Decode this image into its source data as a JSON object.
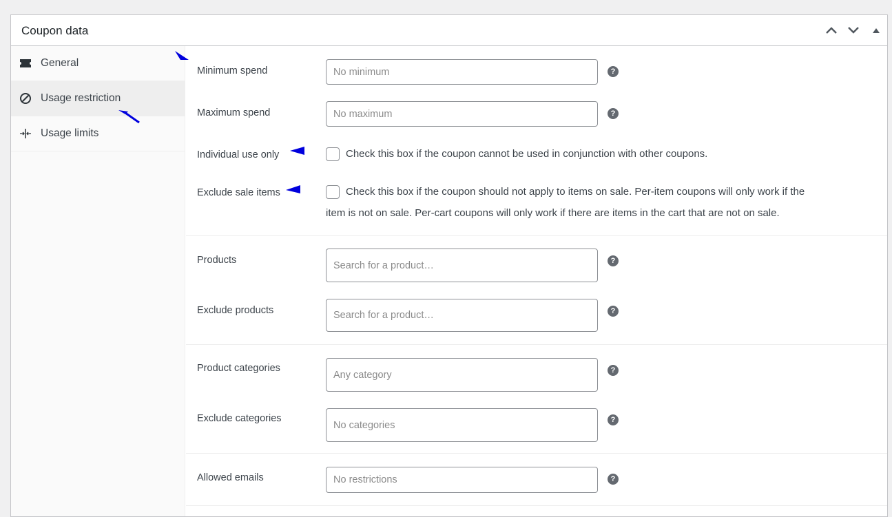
{
  "panel": {
    "title": "Coupon data",
    "controls": [
      "chevron-up-icon",
      "chevron-down-icon",
      "triangle-up-icon"
    ]
  },
  "tabs": [
    {
      "label": "General",
      "icon": "ticket-icon"
    },
    {
      "label": "Usage restriction",
      "icon": "no-entry-icon"
    },
    {
      "label": "Usage limits",
      "icon": "limits-icon"
    }
  ],
  "active_tab": "Usage restriction",
  "fields": {
    "minimum_spend": {
      "label": "Minimum spend",
      "placeholder": "No minimum",
      "value": ""
    },
    "maximum_spend": {
      "label": "Maximum spend",
      "placeholder": "No maximum",
      "value": ""
    },
    "individual_use": {
      "label": "Individual use only",
      "description": "Check this box if the coupon cannot be used in conjunction with other coupons.",
      "checked": false
    },
    "exclude_sale": {
      "label": "Exclude sale items",
      "description_line1": "Check this box if the coupon should not apply to items on sale. Per-item coupons will only work if the",
      "description_line2": "item is not on sale. Per-cart coupons will only work if there are items in the cart that are not on sale.",
      "checked": false
    },
    "products": {
      "label": "Products",
      "placeholder": "Search for a product…"
    },
    "exclude_products": {
      "label": "Exclude products",
      "placeholder": "Search for a product…"
    },
    "product_categories": {
      "label": "Product categories",
      "placeholder": "Any category"
    },
    "exclude_categories": {
      "label": "Exclude categories",
      "placeholder": "No categories"
    },
    "allowed_emails": {
      "label": "Allowed emails",
      "placeholder": "No restrictions"
    }
  },
  "help_glyph": "?",
  "colors": {
    "annotation_arrow": "#0000dd",
    "help_icon": "#646970",
    "active_tab_bg": "#eeeeee",
    "border": "#c3c4c7"
  }
}
